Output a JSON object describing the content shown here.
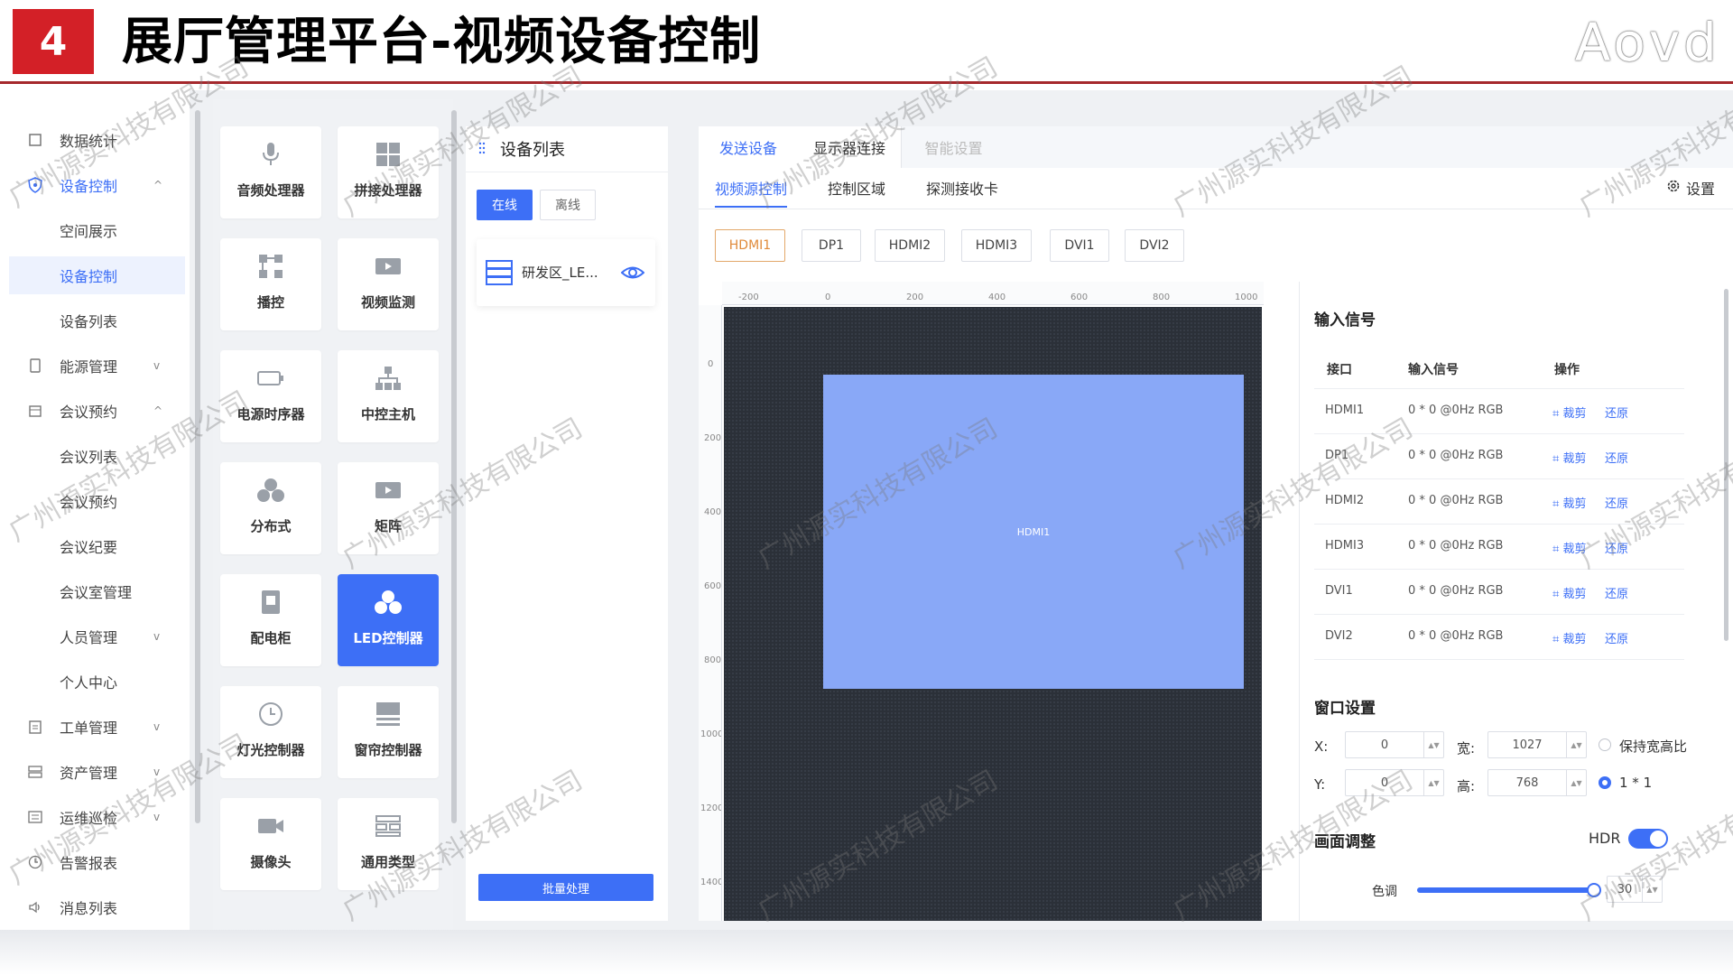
{
  "header": {
    "badge": "4",
    "title": "展厅管理平台-视频设备控制",
    "logo": "Aovd"
  },
  "sidebar": {
    "items": [
      {
        "label": "数据统计",
        "icon": "chart-icon",
        "type": "top"
      },
      {
        "label": "设备控制",
        "icon": "shield-icon",
        "type": "top",
        "chevron": "^"
      },
      {
        "label": "空间展示",
        "type": "sub"
      },
      {
        "label": "设备控制",
        "type": "sub"
      },
      {
        "label": "设备列表",
        "type": "sub"
      },
      {
        "label": "能源管理",
        "icon": "phone-icon",
        "type": "top",
        "chevron": "v"
      },
      {
        "label": "会议预约",
        "icon": "calendar-icon",
        "type": "top",
        "chevron": "^"
      },
      {
        "label": "会议列表",
        "type": "sub"
      },
      {
        "label": "会议预约",
        "type": "sub"
      },
      {
        "label": "会议纪要",
        "type": "sub"
      },
      {
        "label": "会议室管理",
        "type": "sub"
      },
      {
        "label": "人员管理",
        "type": "sub",
        "chevron": "v"
      },
      {
        "label": "个人中心",
        "type": "sub"
      },
      {
        "label": "工单管理",
        "icon": "clipboard-icon",
        "type": "top",
        "chevron": "v"
      },
      {
        "label": "资产管理",
        "icon": "server-icon",
        "type": "top",
        "chevron": "v"
      },
      {
        "label": "运维巡检",
        "icon": "list-icon",
        "type": "top",
        "chevron": "v"
      },
      {
        "label": "告警报表",
        "icon": "clock-icon",
        "type": "top"
      },
      {
        "label": "消息列表",
        "icon": "speaker-icon",
        "type": "top"
      }
    ]
  },
  "devices": [
    {
      "label": "音频处理器",
      "icon": "microphone-icon"
    },
    {
      "label": "拼接处理器",
      "icon": "grid-icon"
    },
    {
      "label": "播控",
      "icon": "network-icon"
    },
    {
      "label": "视频监测",
      "icon": "video-icon"
    },
    {
      "label": "电源时序器",
      "icon": "battery-icon"
    },
    {
      "label": "中控主机",
      "icon": "hierarchy-icon"
    },
    {
      "label": "分布式",
      "icon": "cubes-icon"
    },
    {
      "label": "矩阵",
      "icon": "video-icon"
    },
    {
      "label": "配电柜",
      "icon": "cabinet-icon"
    },
    {
      "label": "LED控制器",
      "icon": "cubes-icon",
      "active": true
    },
    {
      "label": "灯光控制器",
      "icon": "clock-icon"
    },
    {
      "label": "窗帘控制器",
      "icon": "curtain-icon"
    },
    {
      "label": "摄像头",
      "icon": "camera-icon"
    },
    {
      "label": "通用类型",
      "icon": "modules-icon"
    }
  ],
  "device_list": {
    "title": "设备列表",
    "tab_online": "在线",
    "tab_offline": "离线",
    "item_name": "研发区_LE...",
    "batch_button": "批量处理"
  },
  "main": {
    "tabs": [
      "发送设备",
      "显示器连接",
      "智能设置"
    ],
    "subtabs": [
      "视频源控制",
      "控制区域",
      "探测接收卡"
    ],
    "settings_label": "设置",
    "sources": [
      "HDMI1",
      "DP1",
      "HDMI2",
      "HDMI3",
      "DVI1",
      "DVI2"
    ],
    "ruler_x": [
      "-200",
      "0",
      "200",
      "400",
      "600",
      "800",
      "1000"
    ],
    "ruler_y": [
      "0",
      "200",
      "400",
      "600",
      "800",
      "1000",
      "1200",
      "1400"
    ],
    "screen_label": "HDMI1"
  },
  "input_signal": {
    "title": "输入信号",
    "headers": [
      "接口",
      "输入信号",
      "操作"
    ],
    "rows": [
      {
        "port": "HDMI1",
        "signal": "0 * 0 @0Hz RGB",
        "crop": "裁剪",
        "restore": "还原"
      },
      {
        "port": "DP1",
        "signal": "0 * 0 @0Hz RGB",
        "crop": "裁剪",
        "restore": "还原"
      },
      {
        "port": "HDMI2",
        "signal": "0 * 0 @0Hz RGB",
        "crop": "裁剪",
        "restore": "还原"
      },
      {
        "port": "HDMI3",
        "signal": "0 * 0 @0Hz RGB",
        "crop": "裁剪",
        "restore": "还原"
      },
      {
        "port": "DVI1",
        "signal": "0 * 0 @0Hz RGB",
        "crop": "裁剪",
        "restore": "还原"
      },
      {
        "port": "DVI2",
        "signal": "0 * 0 @0Hz RGB",
        "crop": "裁剪",
        "restore": "还原"
      }
    ]
  },
  "window_settings": {
    "title": "窗口设置",
    "x_label": "X:",
    "x_value": "0",
    "y_label": "Y:",
    "y_value": "0",
    "w_label": "宽:",
    "w_value": "1027",
    "h_label": "高:",
    "h_value": "768",
    "keep_ratio": "保持宽高比",
    "one_to_one": "1 * 1"
  },
  "picture": {
    "title": "画面调整",
    "hdr_label": "HDR",
    "hue_label": "色调",
    "hue_value": "30"
  },
  "watermark": "广州源实科技有限公司",
  "colors": {
    "accent": "#3d6ff6",
    "brand_red": "#d32027",
    "canvas": "#2b3038",
    "screen": "#89a8f7"
  }
}
